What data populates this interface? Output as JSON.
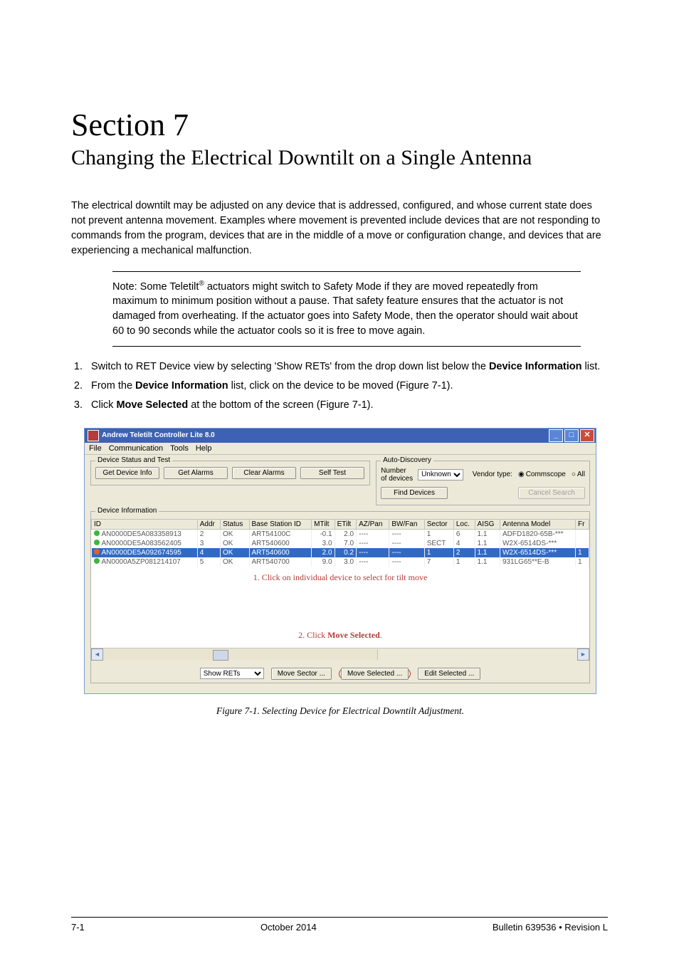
{
  "header": {
    "section_title": "Section 7",
    "section_subtitle": "Changing the Electrical Downtilt on a Single Antenna"
  },
  "intro": "The electrical downtilt may be adjusted on any device that is addressed, configured, and whose current state does not prevent antenna movement. Examples where movement is prevented include devices that are not responding to commands from the program, devices that are in the middle of a move or configuration change, and devices that are experiencing a mechanical malfunction.",
  "note_prefix": "Note: Some Teletilt",
  "note_suffix": " actuators might switch to Safety Mode if they are moved repeatedly from maximum to minimum position without a pause. That safety feature ensures that the actuator is not damaged from overheating. If the actuator goes into Safety Mode, then the operator should wait about 60 to 90 seconds while the actuator cools so it is free to move again.",
  "steps": {
    "s1a": "Switch to RET Device view by selecting 'Show RETs' from the drop down list below the ",
    "s1b": "Device Information",
    "s1c": " list.",
    "s2a": "From the ",
    "s2b": "Device Information",
    "s2c": " list, click on the device to be moved (Figure 7-1).",
    "s3a": "Click ",
    "s3b": "Move Selected",
    "s3c": " at the bottom of the screen (Figure 7-1)."
  },
  "win": {
    "title": "Andrew Teletilt Controller Lite 8.0",
    "menu": [
      "File",
      "Communication",
      "Tools",
      "Help"
    ],
    "group1": {
      "legend": "Device Status and Test",
      "buttons": [
        "Get Device Info",
        "Get Alarms",
        "Clear Alarms",
        "Self Test"
      ]
    },
    "group2": {
      "legend": "Auto-Discovery",
      "num_devices_label": "Number of devices",
      "num_devices_value": "Unknown",
      "vendor_label": "Vendor type:",
      "opt1": "Commscope",
      "opt2": "All",
      "find": "Find Devices",
      "cancel": "Cancel Search"
    },
    "dev_legend": "Device Information",
    "columns": [
      "ID",
      "Addr",
      "Status",
      "Base Station ID",
      "MTilt",
      "ETilt",
      "AZ/Pan",
      "BW/Fan",
      "Sector",
      "Loc.",
      "AISG",
      "Antenna Model",
      "Fr"
    ],
    "rows": [
      {
        "dot": "#3fb43f",
        "id": "AN0000DE5A083358913",
        "addr": "2",
        "status": "OK",
        "bs": "ART54100C",
        "mtilt": "-0.1",
        "etilt": "2.0",
        "az": "----",
        "bw": "----",
        "sector": "1",
        "loc": "6",
        "aisg": "1.1",
        "model": "ADFD1820-65B-***",
        "fr": ""
      },
      {
        "dot": "#3fb43f",
        "id": "AN0000DE5A083562405",
        "addr": "3",
        "status": "OK",
        "bs": "ART540600",
        "mtilt": "3.0",
        "etilt": "7.0",
        "az": "----",
        "bw": "----",
        "sector": "SECT",
        "loc": "4",
        "aisg": "1.1",
        "model": "W2X-6514DS-***",
        "fr": ""
      },
      {
        "dot": "#e06030",
        "id": "AN0000DE5A092674595",
        "addr": "4",
        "status": "OK",
        "bs": "ART540600",
        "mtilt": "2.0",
        "etilt": "0.2",
        "az": "----",
        "bw": "----",
        "sector": "1",
        "loc": "2",
        "aisg": "1.1",
        "model": "W2X-6514DS-***",
        "fr": "1",
        "hilite": true
      },
      {
        "dot": "#3fb43f",
        "id": "AN0000A5ZP081214107",
        "addr": "5",
        "status": "OK",
        "bs": "ART540700",
        "mtilt": "9.0",
        "etilt": "3.0",
        "az": "----",
        "bw": "----",
        "sector": "7",
        "loc": "1",
        "aisg": "1.1",
        "model": "931LG65**E-B",
        "fr": "1"
      }
    ],
    "annot1": "1. Click on individual device to select for tilt move",
    "annot2_a": "2. Click ",
    "annot2_b": "Move Selected",
    "annot2_c": ".",
    "bottom": {
      "show": "Show RETs",
      "move_sector": "Move Sector ...",
      "move_selected": "Move Selected ...",
      "edit_selected": "Edit Selected ..."
    }
  },
  "caption": "Figure 7-1. Selecting Device for Electrical Downtilt Adjustment.",
  "footer": {
    "left": "7-1",
    "center": "October 2014",
    "right": "Bulletin 639536 • Revision L"
  }
}
